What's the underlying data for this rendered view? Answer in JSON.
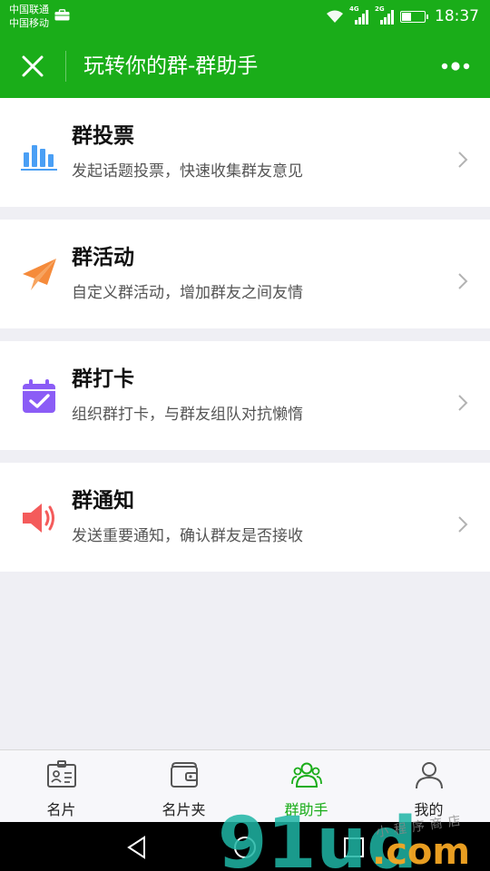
{
  "status_bar": {
    "carrier_1": "中国联通",
    "carrier_2": "中国移动",
    "net_1": "4G",
    "net_2": "2G",
    "time": "18:37"
  },
  "nav": {
    "title": "玩转你的群-群助手"
  },
  "features": [
    {
      "title": "群投票",
      "desc": "发起话题投票，快速收集群友意见",
      "icon": "bar-chart-icon",
      "color": "#4a9ff5"
    },
    {
      "title": "群活动",
      "desc": "自定义群活动，增加群友之间友情",
      "icon": "paper-plane-icon",
      "color": "#f58b3b"
    },
    {
      "title": "群打卡",
      "desc": "组织群打卡，与群友组队对抗懒惰",
      "icon": "calendar-check-icon",
      "color": "#8b5cf6"
    },
    {
      "title": "群通知",
      "desc": "发送重要通知，确认群友是否接收",
      "icon": "speaker-icon",
      "color": "#f45b5b"
    }
  ],
  "tabs": [
    {
      "label": "名片",
      "icon": "card-icon",
      "active": false
    },
    {
      "label": "名片夹",
      "icon": "wallet-icon",
      "active": false
    },
    {
      "label": "群助手",
      "icon": "group-icon",
      "active": true
    },
    {
      "label": "我的",
      "icon": "person-icon",
      "active": false
    }
  ],
  "colors": {
    "brand": "#1aad19",
    "background": "#efeff4"
  },
  "watermark": {
    "big": "91ud",
    "suffix": ".com",
    "small": "小程序商店"
  }
}
